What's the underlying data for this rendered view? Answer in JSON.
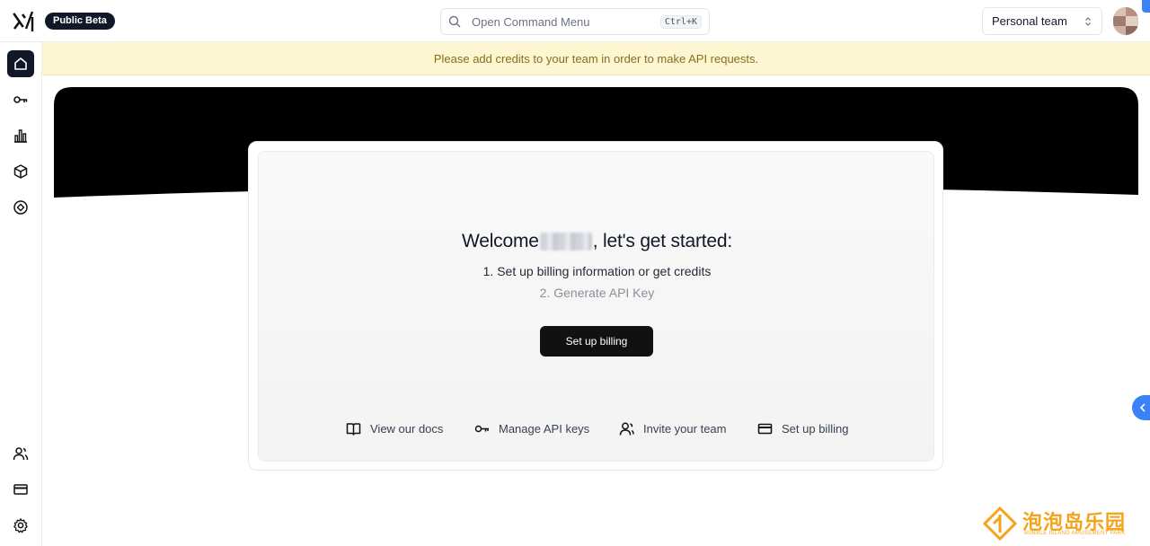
{
  "header": {
    "logo_text": "xAI",
    "beta_badge": "Public Beta",
    "command_menu": {
      "placeholder": "Open Command Menu",
      "shortcut": "Ctrl+K"
    },
    "team_selector": {
      "selected": "Personal team"
    }
  },
  "banner": {
    "text": "Please add credits to your team in order to make API requests."
  },
  "sidebar": {
    "top_items": [
      {
        "icon": "home-icon",
        "active": true
      },
      {
        "icon": "key-icon",
        "active": false
      },
      {
        "icon": "bar-chart-icon",
        "active": false
      },
      {
        "icon": "cube-icon",
        "active": false
      },
      {
        "icon": "compass-icon",
        "active": false
      }
    ],
    "bottom_items": [
      {
        "icon": "users-icon"
      },
      {
        "icon": "credit-card-icon"
      },
      {
        "icon": "gear-icon"
      }
    ]
  },
  "welcome": {
    "prefix": "Welcome",
    "suffix": ", let's get started:",
    "steps": [
      "1. Set up billing information or get credits",
      "2. Generate API Key"
    ],
    "primary_button": "Set up billing"
  },
  "quick_links": [
    {
      "icon": "book-icon",
      "label": "View our docs"
    },
    {
      "icon": "key-icon",
      "label": "Manage API keys"
    },
    {
      "icon": "user-plus-icon",
      "label": "Invite your team"
    },
    {
      "icon": "credit-card-icon",
      "label": "Set up billing"
    }
  ],
  "watermark": {
    "cn": "泡泡岛乐园",
    "en": "BUBBLE ISLAND AMUSEMENT PARK"
  },
  "colors": {
    "accent_dark": "#111827",
    "banner_bg": "#fdf6d3",
    "banner_text": "#8a6d1b",
    "handle_blue": "#3b82f6",
    "watermark": "#f5a31a"
  }
}
